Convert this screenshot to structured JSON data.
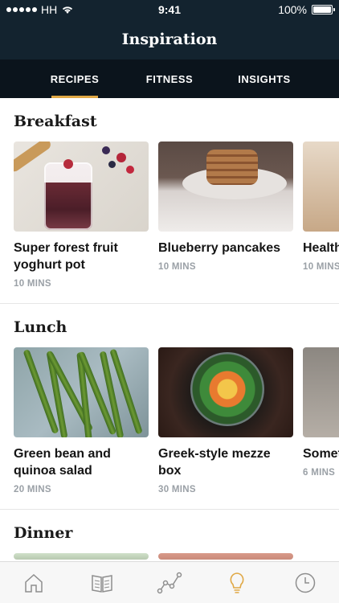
{
  "status": {
    "carrier": "HH",
    "time": "9:41",
    "battery": "100%"
  },
  "header": {
    "title": "Inspiration"
  },
  "tabs": [
    {
      "label": "RECIPES",
      "active": true
    },
    {
      "label": "FITNESS",
      "active": false
    },
    {
      "label": "INSIGHTS",
      "active": false
    }
  ],
  "sections": [
    {
      "title": "Breakfast",
      "cards": [
        {
          "title": "Super forest fruit yoghurt pot",
          "time": "10 MINS"
        },
        {
          "title": "Blueberry pancakes",
          "time": "10 MINS"
        },
        {
          "title": "Health",
          "time": "10 MINS"
        }
      ]
    },
    {
      "title": "Lunch",
      "cards": [
        {
          "title": "Green bean and quinoa salad",
          "time": "20 MINS"
        },
        {
          "title": "Greek-style mezze box",
          "time": "30 MINS"
        },
        {
          "title": "Somet",
          "time": "6 MINS"
        }
      ]
    },
    {
      "title": "Dinner",
      "cards": []
    }
  ],
  "tabbar": {
    "items": [
      {
        "icon": "home-icon",
        "active": false
      },
      {
        "icon": "book-icon",
        "active": false
      },
      {
        "icon": "progress-chart-icon",
        "active": false
      },
      {
        "icon": "lightbulb-icon",
        "active": true
      },
      {
        "icon": "clock-icon",
        "active": false
      }
    ],
    "active_color": "#e0a845",
    "inactive_color": "#8e8e8e"
  },
  "colors": {
    "header_bg": "#13232f",
    "tabs_bg": "#0b141c",
    "accent": "#e0a845"
  }
}
